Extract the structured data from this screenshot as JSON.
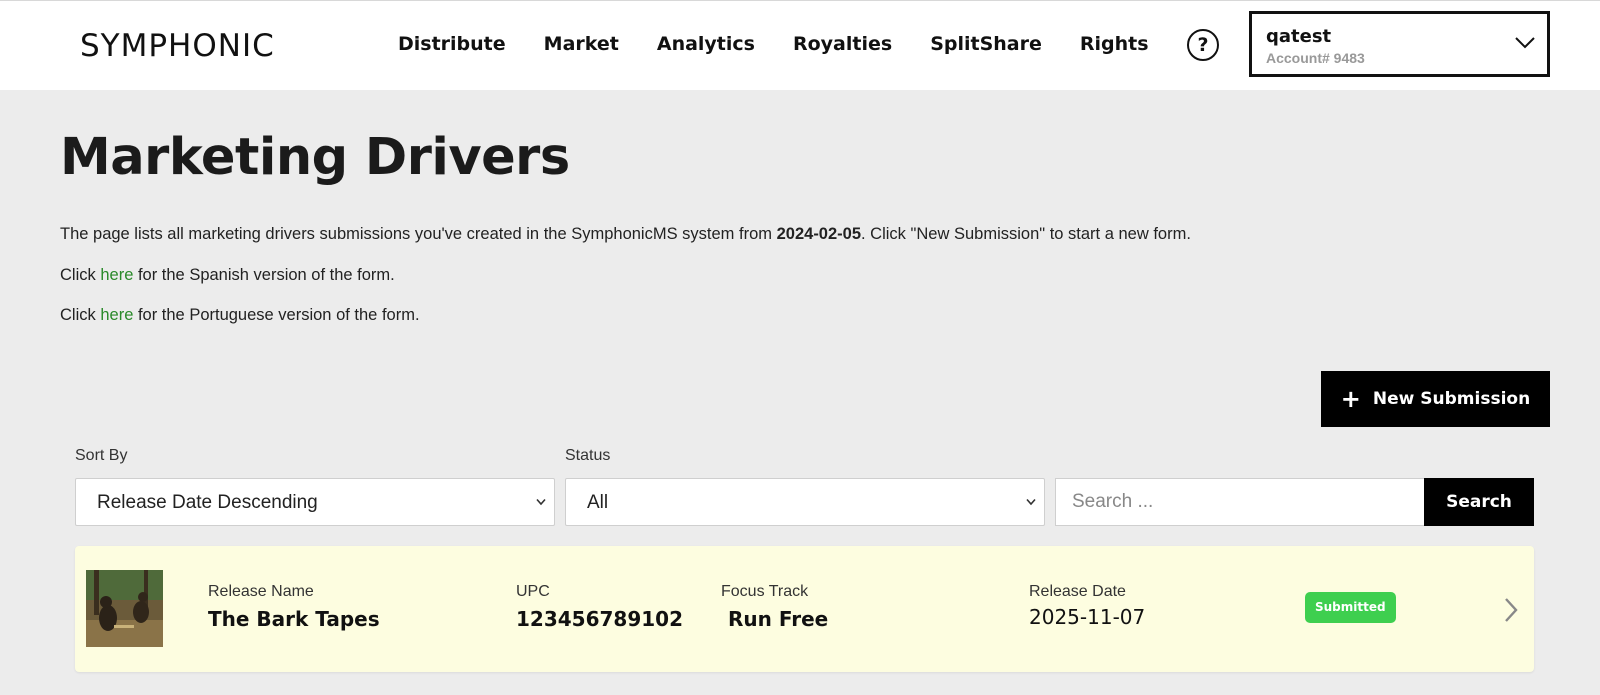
{
  "header": {
    "logo": "SYMPHONIC",
    "nav": [
      "Distribute",
      "Market",
      "Analytics",
      "Royalties",
      "SplitShare",
      "Rights"
    ],
    "help_icon": "question-circle-icon",
    "account": {
      "name": "qatest",
      "number": "Account# 9483"
    }
  },
  "page": {
    "title": "Marketing Drivers",
    "desc1_pre": "The page lists all marketing drivers submissions you've created in the SymphonicMS system from ",
    "desc1_date": "2024-02-05",
    "desc1_post": ". Click \"New Submission\" to start a new form.",
    "desc2_pre": "Click ",
    "desc2_link": "here",
    "desc2_post": " for the Spanish version of the form.",
    "desc3_pre": "Click ",
    "desc3_link": "here",
    "desc3_post": " for the Portuguese version of the form.",
    "new_submission_label": "New Submission"
  },
  "filters": {
    "sort_label": "Sort By",
    "sort_value": "Release Date Descending",
    "status_label": "Status",
    "status_value": "All",
    "search_placeholder": "Search ...",
    "search_button": "Search"
  },
  "rows": [
    {
      "release_name_label": "Release Name",
      "release_name": "The Bark Tapes",
      "upc_label": "UPC",
      "upc": "123456789102",
      "focus_track_label": "Focus Track",
      "focus_track": "Run Free",
      "release_date_label": "Release Date",
      "release_date": "2025-11-07",
      "status": "Submitted",
      "status_color": "#3ecf4f"
    }
  ],
  "colors": {
    "accent_link": "#2a8a2a",
    "row_bg": "#fdfde0",
    "button_bg": "#000000"
  }
}
